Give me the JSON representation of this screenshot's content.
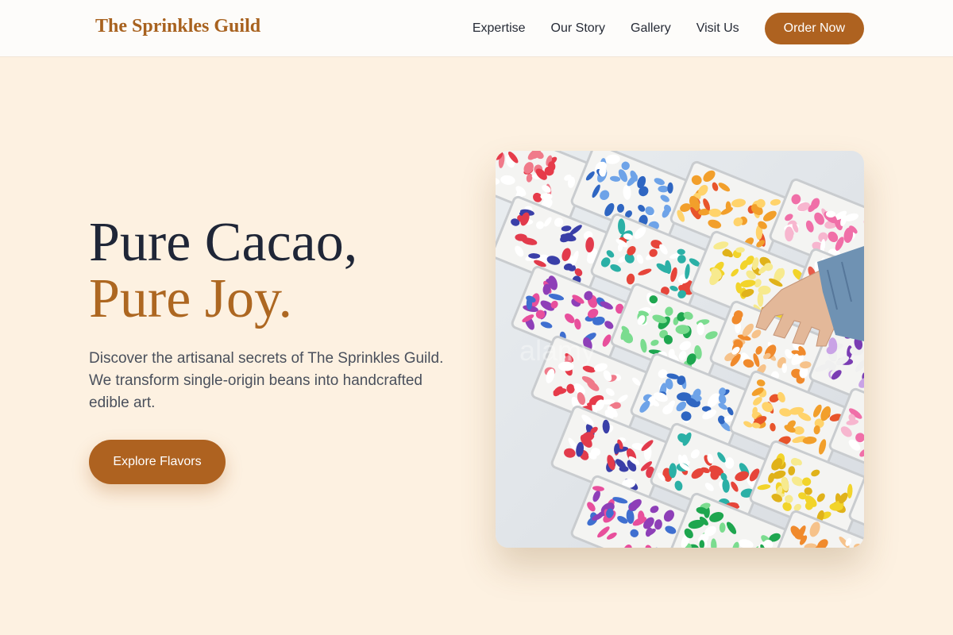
{
  "nav": {
    "brand": "The Sprinkles Guild",
    "links": [
      "Expertise",
      "Our Story",
      "Gallery",
      "Visit Us"
    ],
    "cta": "Order Now"
  },
  "hero": {
    "title_line1": "Pure Cacao,",
    "title_line2": "Pure Joy.",
    "description": "Discover the artisanal secrets of The Sprinkles Guild. We transform single-origin beans into handcrafted edible art.",
    "cta": "Explore Flavors",
    "image_watermark": "alamy"
  },
  "colors": {
    "background": "#fdf1e1",
    "accent": "#ae6220",
    "heading": "#1f2637",
    "body_text": "#4a505c"
  }
}
